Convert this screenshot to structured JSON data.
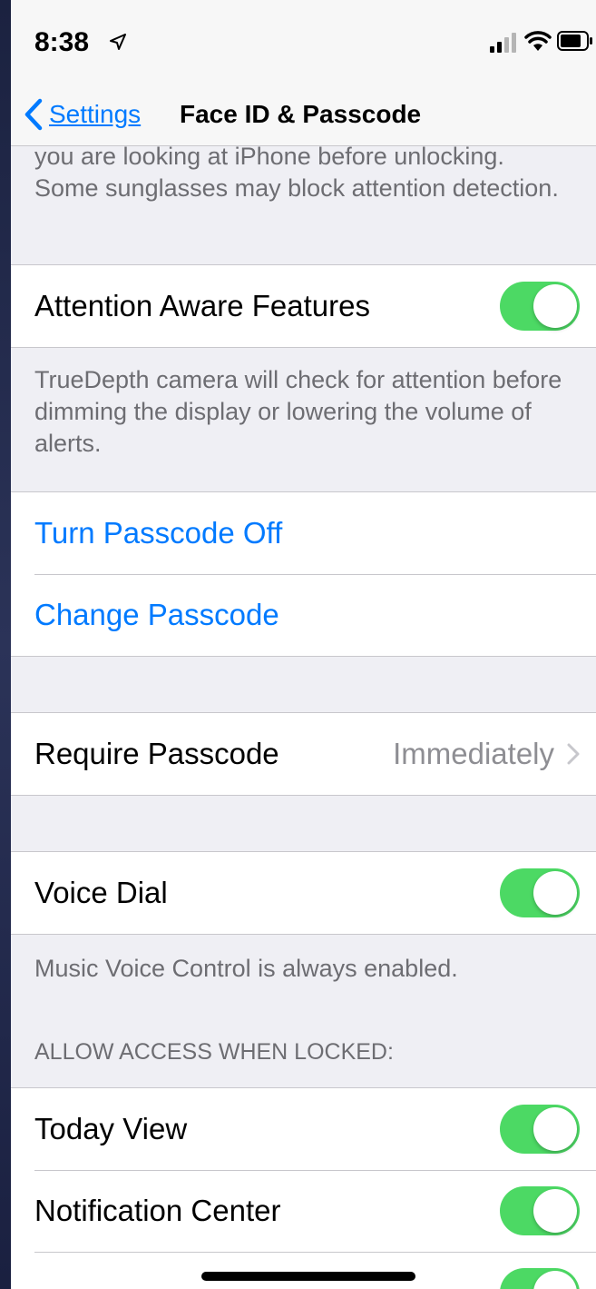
{
  "status_bar": {
    "time": "8:38",
    "icons": [
      "location-arrow-icon",
      "signal-icon",
      "wifi-icon",
      "battery-icon"
    ]
  },
  "nav": {
    "back_label": "Settings",
    "title": "Face ID & Passcode"
  },
  "top_description": "you are looking at iPhone before unlocking. Some sunglasses may block attention detection.",
  "attention": {
    "label": "Attention Aware Features",
    "enabled": true,
    "footer": "TrueDepth camera will check for attention before dimming the display or lowering the volume of alerts."
  },
  "passcode_actions": {
    "turn_off": "Turn Passcode Off",
    "change": "Change Passcode"
  },
  "require_passcode": {
    "label": "Require Passcode",
    "value": "Immediately"
  },
  "voice_dial": {
    "label": "Voice Dial",
    "enabled": true,
    "footer": "Music Voice Control is always enabled."
  },
  "locked_access": {
    "header": "ALLOW ACCESS WHEN LOCKED:",
    "items": [
      {
        "label": "Today View",
        "enabled": true
      },
      {
        "label": "Notification Center",
        "enabled": true
      }
    ]
  },
  "colors": {
    "accent": "#007aff",
    "toggle_on": "#4cd964",
    "secondary_text": "#6d6d72",
    "grouped_background": "#efeff4"
  }
}
